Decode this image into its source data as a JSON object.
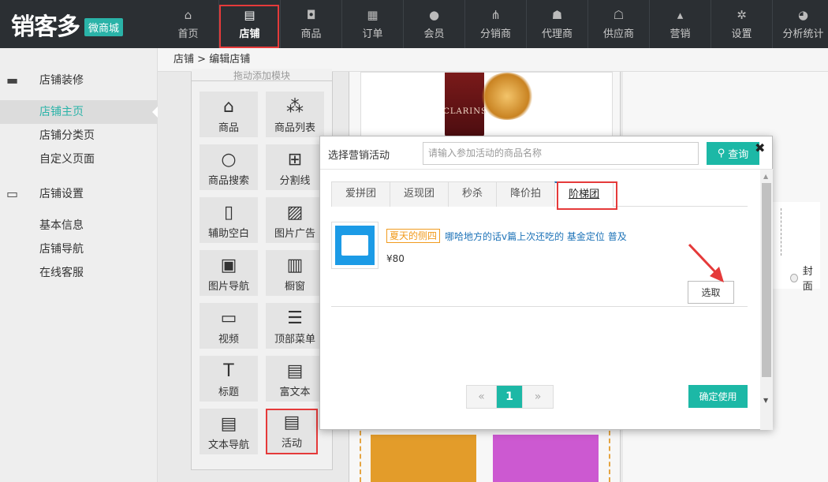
{
  "logo": {
    "main": "销客多",
    "badge": "微商城"
  },
  "nav": [
    {
      "label": "首页",
      "icon": "home-icon",
      "glyph": "⌂"
    },
    {
      "label": "店铺",
      "icon": "store-icon",
      "glyph": "▤",
      "active": true
    },
    {
      "label": "商品",
      "icon": "bag-icon",
      "glyph": "◘"
    },
    {
      "label": "订单",
      "icon": "clipboard-icon",
      "glyph": "▦"
    },
    {
      "label": "会员",
      "icon": "user-icon",
      "glyph": "●"
    },
    {
      "label": "分销商",
      "icon": "sitemap-icon",
      "glyph": "⋔"
    },
    {
      "label": "代理商",
      "icon": "agent-icon",
      "glyph": "☗"
    },
    {
      "label": "供应商",
      "icon": "supplier-icon",
      "glyph": "☖"
    },
    {
      "label": "营销",
      "icon": "chart-icon",
      "glyph": "▴"
    },
    {
      "label": "设置",
      "icon": "gear-icon",
      "glyph": "✲"
    },
    {
      "label": "分析统计",
      "icon": "pie-icon",
      "glyph": "◕"
    }
  ],
  "sidebar": {
    "group1": {
      "label": "店铺装修",
      "icon": "brush-icon"
    },
    "group1_items": [
      "店铺主页",
      "店铺分类页",
      "自定义页面"
    ],
    "group2": {
      "label": "店铺设置",
      "icon": "shop-settings-icon"
    },
    "group2_items": [
      "基本信息",
      "店铺导航",
      "在线客服"
    ]
  },
  "breadcrumb": {
    "root": "店铺",
    "sep": ">",
    "current": "编辑店铺"
  },
  "widget_panel": {
    "title": "拖动添加模块",
    "widgets": [
      {
        "label": "商品",
        "glyph": "⌂"
      },
      {
        "label": "商品列表",
        "glyph": "⁂"
      },
      {
        "label": "商品搜索",
        "glyph": "○"
      },
      {
        "label": "分割线",
        "glyph": "⊞"
      },
      {
        "label": "辅助空白",
        "glyph": "▯"
      },
      {
        "label": "图片广告",
        "glyph": "▨"
      },
      {
        "label": "图片导航",
        "glyph": "▣"
      },
      {
        "label": "橱窗",
        "glyph": "▥"
      },
      {
        "label": "视频",
        "glyph": "▭"
      },
      {
        "label": "顶部菜单",
        "glyph": "☰"
      },
      {
        "label": "标题",
        "glyph": "T"
      },
      {
        "label": "富文本",
        "glyph": "▤"
      },
      {
        "label": "文本导航",
        "glyph": "▤"
      },
      {
        "label": "活动",
        "glyph": "▤"
      }
    ]
  },
  "preview": {
    "brand": "CLARINS"
  },
  "right_panel": {
    "radio_label": "封面"
  },
  "modal": {
    "title": "选择营销活动",
    "search_placeholder": "请输入参加活动的商品名称",
    "search_button": "查询",
    "close": "✖",
    "tabs": [
      "爱拼团",
      "返现团",
      "秒杀",
      "降价拍",
      "阶梯团"
    ],
    "item": {
      "tag": "夏天的侧四",
      "name": "哪哈地方的话v篇上次还吃的 基金定位 普及",
      "price": "¥80",
      "pick_button": "选取"
    },
    "pager": {
      "prev": "«",
      "current": "1",
      "next": "»"
    },
    "confirm": "确定使用"
  },
  "colors": {
    "accent": "#1cb8a6",
    "highlight": "#e53a3a",
    "nav_bg": "#2b2f33",
    "tag": "#f19b1f"
  }
}
